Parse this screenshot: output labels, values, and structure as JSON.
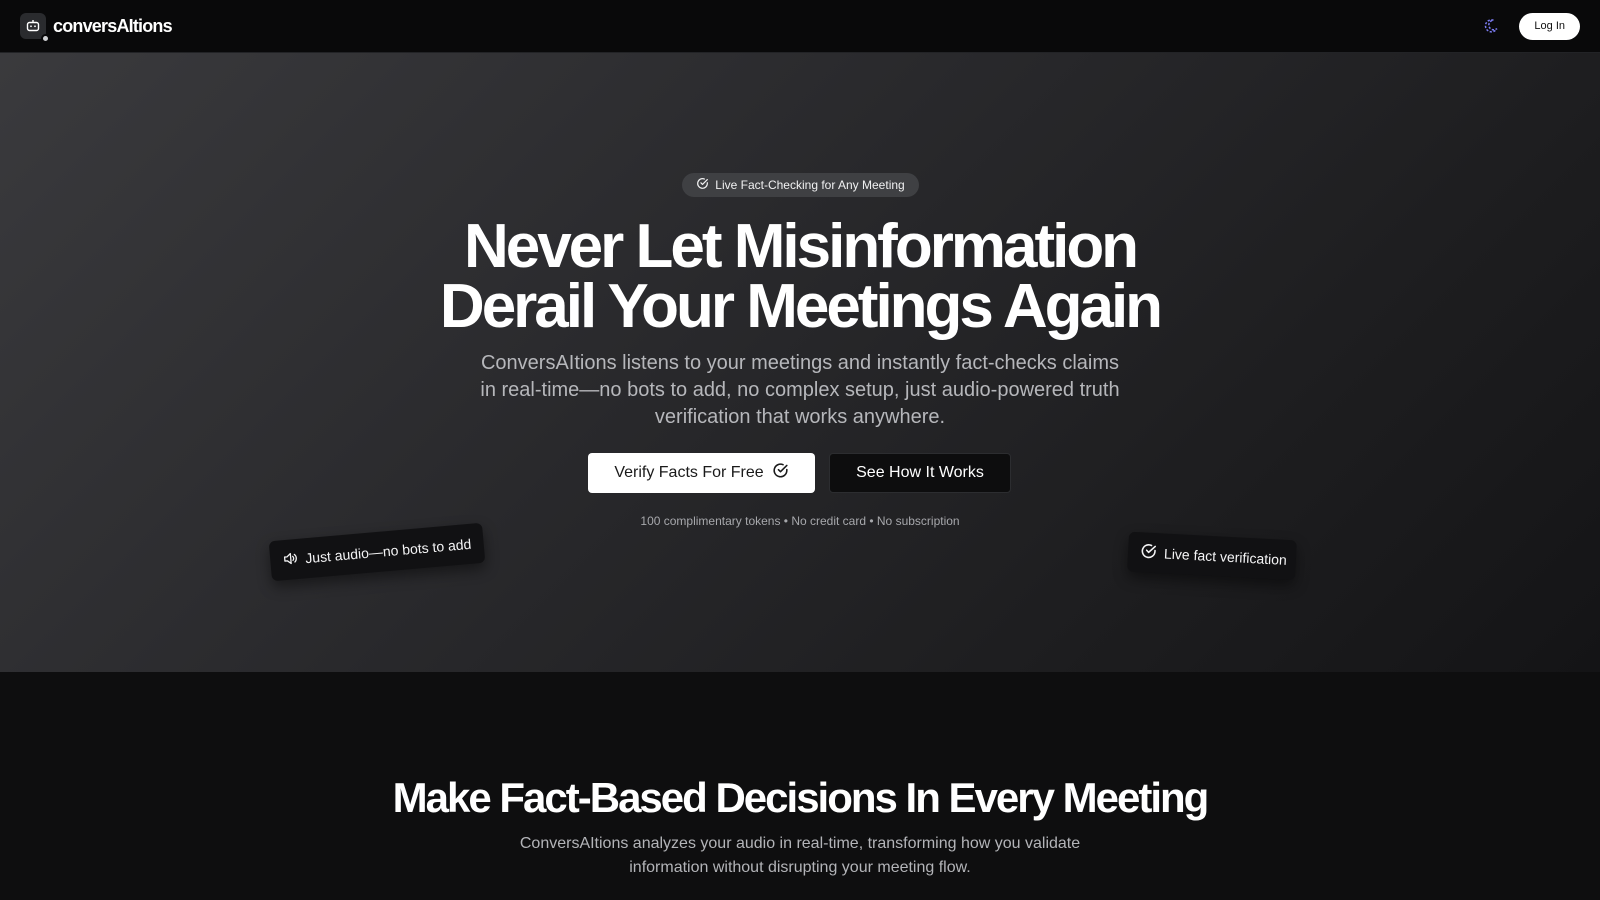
{
  "header": {
    "brand": "conversAItions",
    "login_label": "Log In"
  },
  "hero": {
    "badge": "Live Fact-Checking for Any Meeting",
    "title_line1": "Never Let Misinformation",
    "title_line2": "Derail Your Meetings Again",
    "subtitle": "ConversAItions listens to your meetings and instantly fact-checks claims in real-time—no bots to add, no complex setup, just audio-powered truth verification that works anywhere.",
    "primary_cta": "Verify Facts For Free",
    "secondary_cta": "See How It Works",
    "note": "100 complimentary tokens • No credit card • No subscription",
    "chip_left": "Just audio—no bots to add",
    "chip_right": "Live fact verification"
  },
  "section2": {
    "title": "Make Fact-Based Decisions In Every Meeting",
    "subtitle": "ConversAItions analyzes your audio in real-time, transforming how you validate information without disrupting your meeting flow."
  },
  "icons": {
    "brand": "bot-icon",
    "theme": "moon-icon",
    "badge": "check-circle-icon",
    "primary_cta": "check-circle-icon",
    "chip_left": "speaker-icon",
    "chip_right": "check-circle-icon"
  },
  "colors": {
    "accent_theme_icon": "#7c7cf2",
    "primary_button_bg": "#ffffff",
    "page_bg": "#0e0e0f"
  }
}
